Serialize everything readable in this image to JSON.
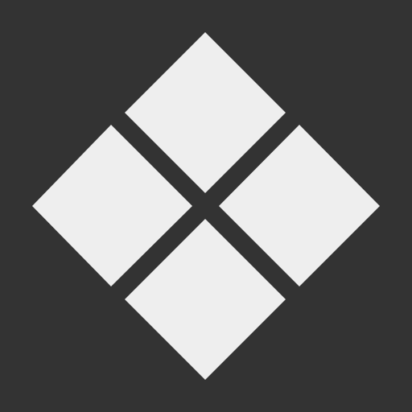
{
  "icon": {
    "name": "four-diamond-tiles-icon",
    "background_color": "#333333",
    "tile_color": "#EEEEEE",
    "tiles": [
      {
        "name": "tile-top"
      },
      {
        "name": "tile-left"
      },
      {
        "name": "tile-right"
      },
      {
        "name": "tile-bottom"
      }
    ]
  }
}
